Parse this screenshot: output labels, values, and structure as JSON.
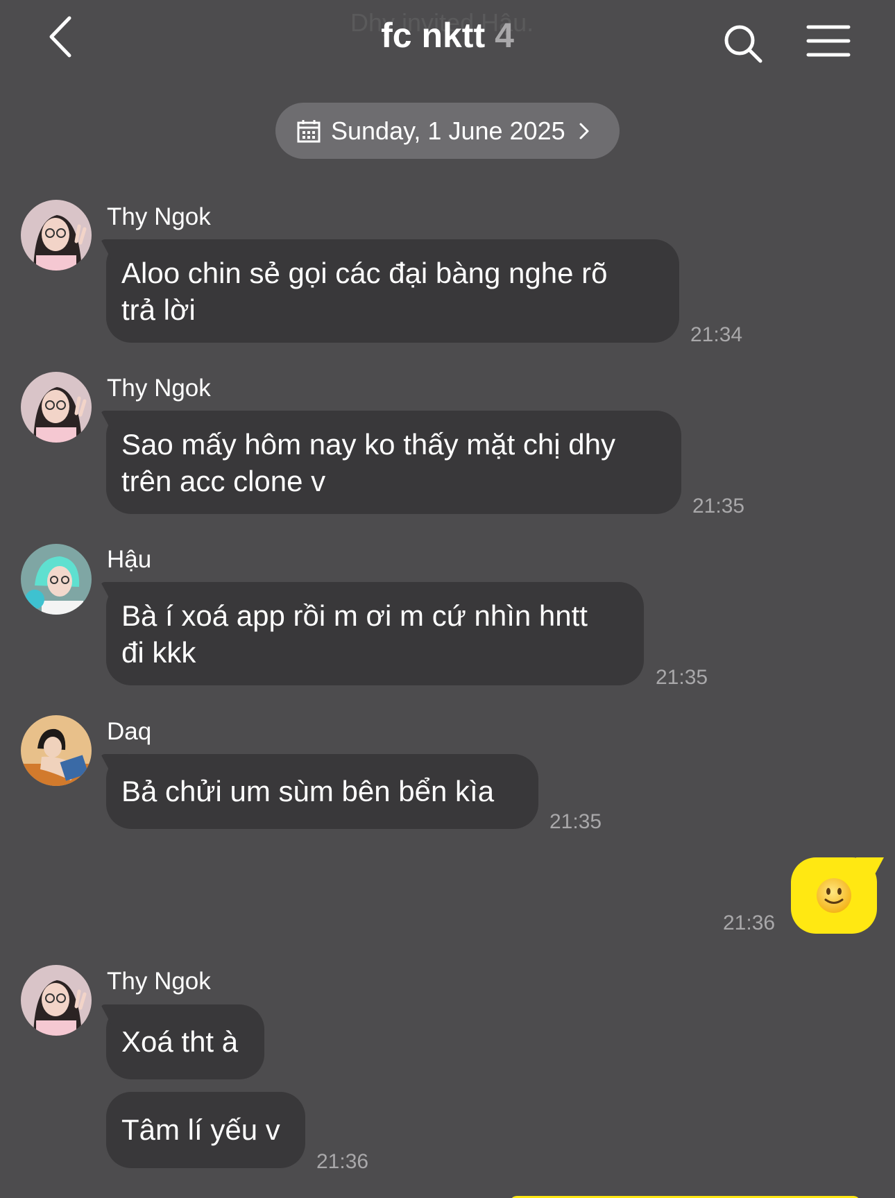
{
  "header": {
    "system_note": "Dhy invited Hậu.",
    "title": "fc nktt",
    "member_count": "4",
    "back_icon": "chevron-left-icon",
    "search_icon": "search-icon",
    "menu_icon": "hamburger-menu-icon"
  },
  "date_pill": {
    "label": "Sunday, 1 June 2025",
    "icon": "calendar-icon",
    "chevron": "chevron-right-icon"
  },
  "colors": {
    "background": "#4d4c4e",
    "bubble_other": "#39383a",
    "bubble_me": "#ffe812",
    "timestamp": "#a9a8aa",
    "pill": "#6e6d70"
  },
  "messages": [
    {
      "sender": "Thy Ngok",
      "text_lines": [
        "Aloo chin sẻ gọi các đại bàng nghe rõ",
        "trả lời"
      ],
      "time": "21:34"
    },
    {
      "sender": "Thy Ngok",
      "text_lines": [
        "Sao mấy hôm nay ko thấy mặt chị dhy",
        "trên acc clone v"
      ],
      "time": "21:35"
    },
    {
      "sender": "Hậu",
      "text_lines": [
        "Bà í xoá app rồi m ơi m cứ nhìn hntt",
        "đi kkk"
      ],
      "time": "21:35"
    },
    {
      "sender": "Daq",
      "text_lines": [
        "Bả chửi um sùm bên bển kìa"
      ],
      "time": "21:35"
    },
    {
      "sender": "me",
      "emoji": "🙂",
      "time": "21:36"
    },
    {
      "sender": "Thy Ngok",
      "text_lines": [
        "Xoá tht à"
      ]
    },
    {
      "sender": "Thy Ngok",
      "text_lines": [
        "Tâm lí yếu v"
      ],
      "time": "21:36"
    }
  ]
}
